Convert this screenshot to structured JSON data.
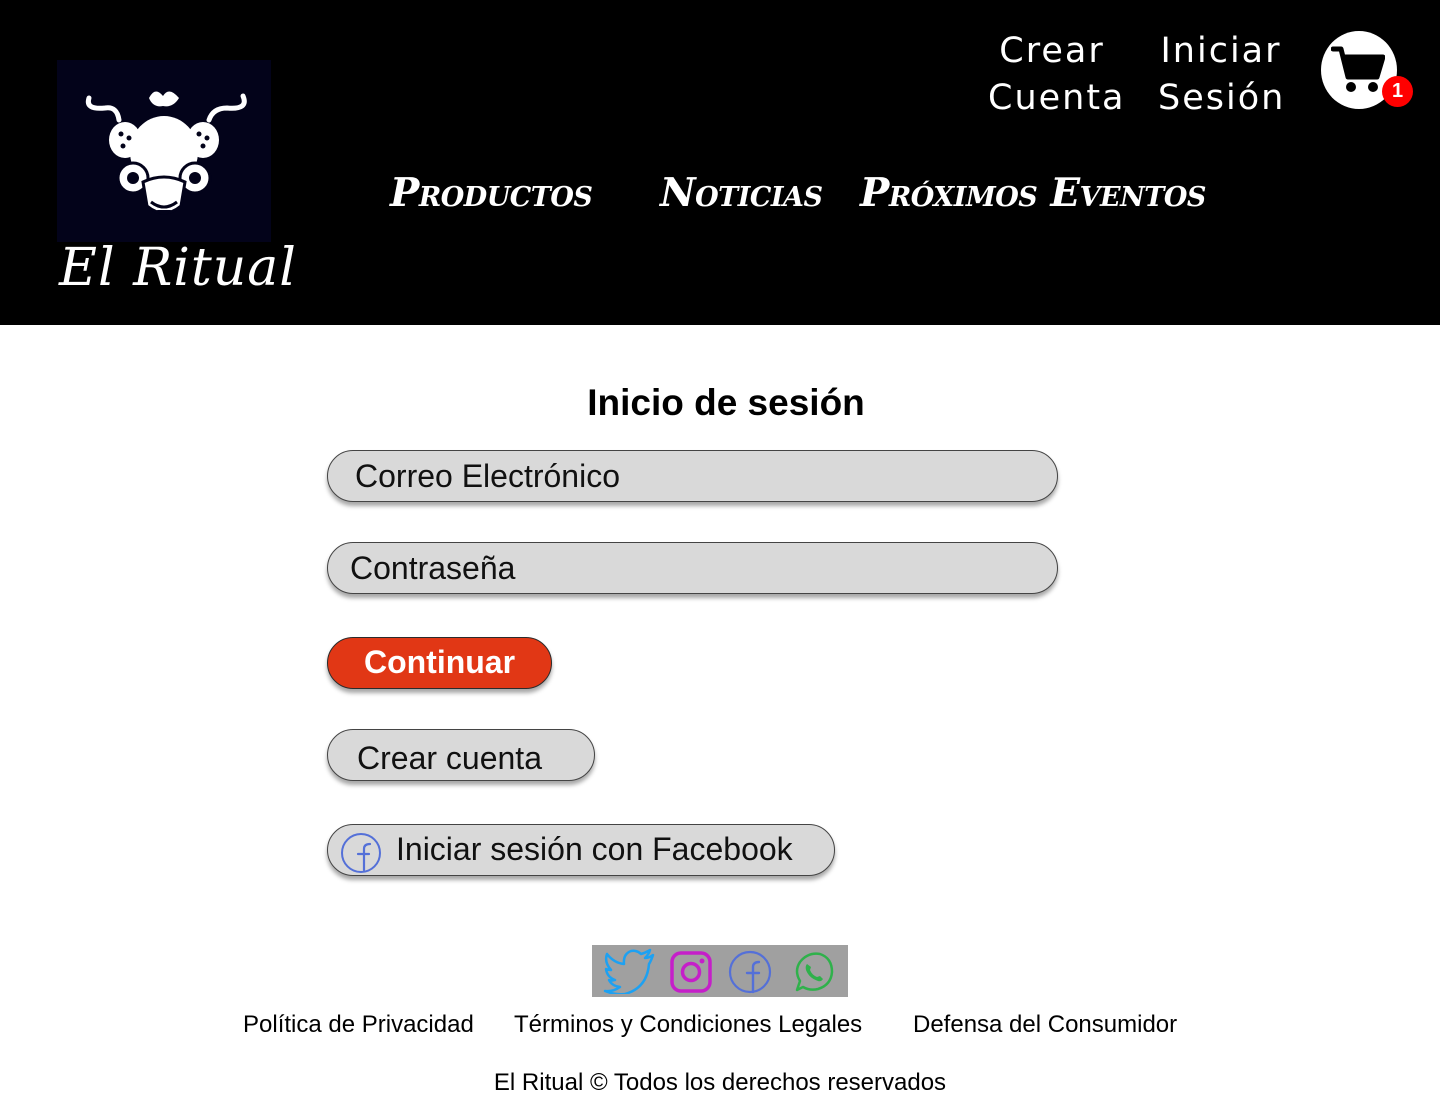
{
  "header": {
    "logo_text": "El Ritual",
    "nav": {
      "products": "Productos",
      "news": "Noticias",
      "events": "Próximos Eventos"
    },
    "account": {
      "create_line1": "Crear",
      "create_line2": "Cuenta",
      "login_line1": "Iniciar",
      "login_line2": "Sesión"
    },
    "cart": {
      "icon": "shopping-cart-icon",
      "count": "1"
    }
  },
  "login": {
    "title": "Inicio de sesión",
    "email_placeholder": "Correo Electrónico",
    "password_placeholder": "Contraseña",
    "continue_label": "Continuar",
    "create_account_label": "Crear cuenta",
    "facebook_label": "Iniciar sesión con Facebook"
  },
  "footer": {
    "social": [
      "twitter-icon",
      "instagram-icon",
      "facebook-icon",
      "whatsapp-icon"
    ],
    "links": {
      "privacy": "Política de Privacidad",
      "terms": "Términos y Condiciones Legales",
      "consumer": "Defensa del Consumidor"
    },
    "copyright": "El Ritual © Todos los derechos reservados"
  },
  "colors": {
    "header_bg": "#000000",
    "accent_button": "#e13715",
    "field_bg": "#d9d9d9",
    "badge": "#ff0000",
    "social_bar": "#a0a0a0",
    "twitter": "#1da1f2",
    "instagram": "#c51fc9",
    "facebook": "#5470d8",
    "whatsapp": "#2fb14b"
  }
}
